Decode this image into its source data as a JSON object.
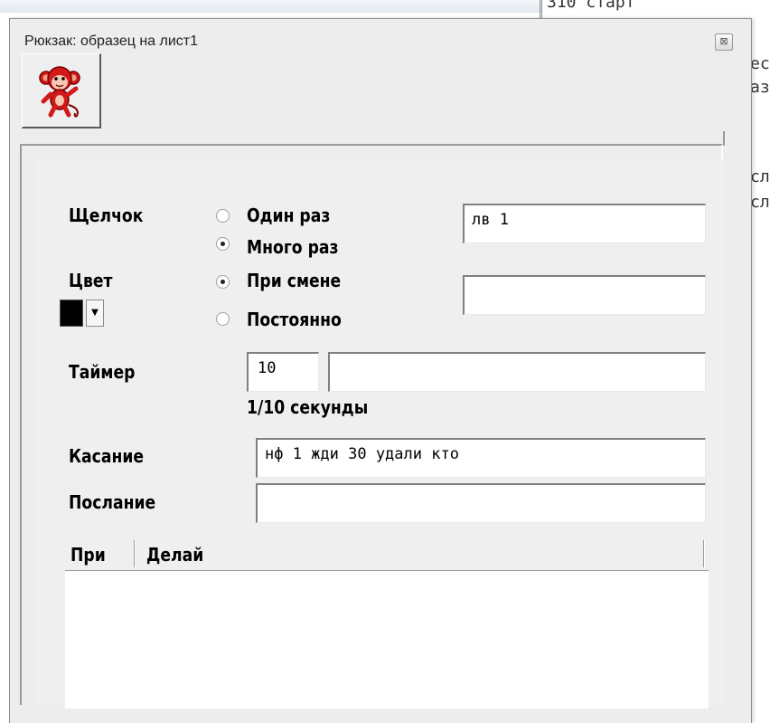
{
  "background": {
    "top_text": "310 старт",
    "side_lines": [
      "ес",
      "аз",
      "сл",
      "сл"
    ]
  },
  "dialog": {
    "title": "Рюкзак: образец на лист1",
    "close_glyph": "⊠",
    "toolbar": {
      "icon": "monkey-icon"
    },
    "click": {
      "label": "Щелчок",
      "options": [
        "Один раз",
        "Много раз"
      ],
      "selected": "Много раз",
      "command": "лв 1"
    },
    "color": {
      "label": "Цвет",
      "value": "#000000",
      "dropdown_glyph": "▼",
      "options": [
        "При смене",
        "Постоянно"
      ],
      "selected": "При смене",
      "command": ""
    },
    "timer": {
      "label": "Таймер",
      "value": "10",
      "command": "",
      "unit": "1/10 секунды"
    },
    "touch": {
      "label": "Касание",
      "command": "нф 1 жди 30 удали кто"
    },
    "message": {
      "label": "Послание",
      "command": ""
    },
    "grid": {
      "columns": [
        "При",
        "Делай"
      ],
      "rows": []
    }
  }
}
